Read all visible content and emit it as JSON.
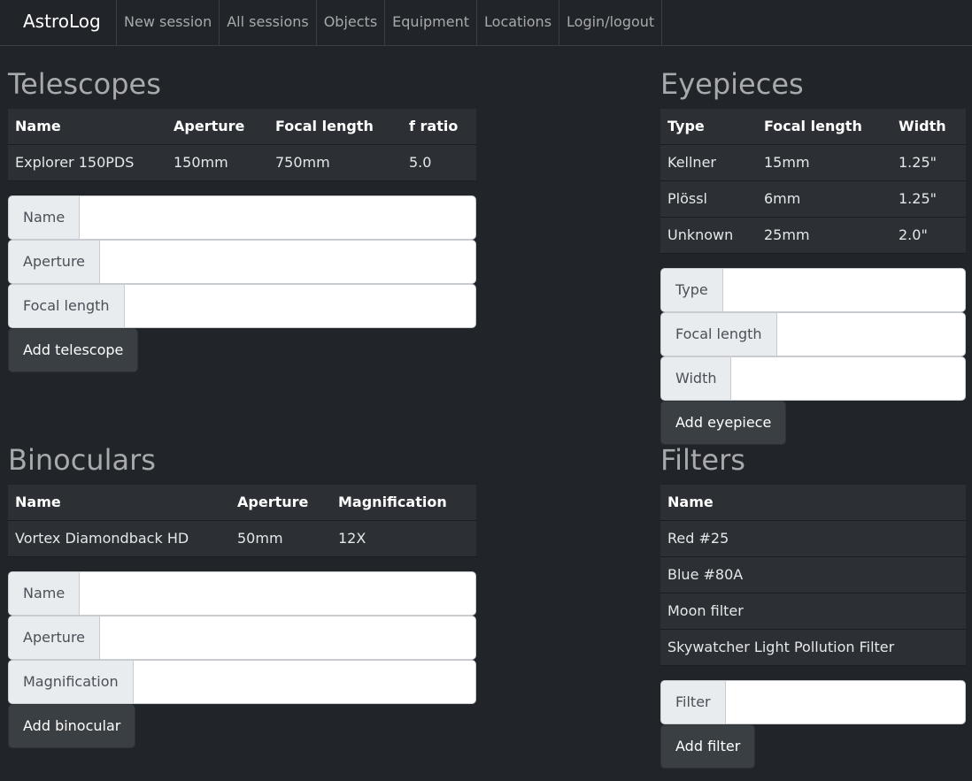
{
  "nav": {
    "brand": "AstroLog",
    "items": [
      "New session",
      "All sessions",
      "Objects",
      "Equipment",
      "Locations",
      "Login/logout"
    ]
  },
  "telescopes": {
    "title": "Telescopes",
    "headers": [
      "Name",
      "Aperture",
      "Focal length",
      "f ratio"
    ],
    "rows": [
      [
        "Explorer 150PDS",
        "150mm",
        "750mm",
        "5.0"
      ]
    ],
    "form": {
      "fields": [
        "Name",
        "Aperture",
        "Focal length"
      ],
      "button": "Add telescope"
    }
  },
  "eyepieces": {
    "title": "Eyepieces",
    "headers": [
      "Type",
      "Focal length",
      "Width"
    ],
    "rows": [
      [
        "Kellner",
        "15mm",
        "1.25\""
      ],
      [
        "Plössl",
        "6mm",
        "1.25\""
      ],
      [
        "Unknown",
        "25mm",
        "2.0\""
      ]
    ],
    "form": {
      "fields": [
        "Type",
        "Focal length",
        "Width"
      ],
      "button": "Add eyepiece"
    }
  },
  "binoculars": {
    "title": "Binoculars",
    "headers": [
      "Name",
      "Aperture",
      "Magnification"
    ],
    "rows": [
      [
        "Vortex Diamondback HD",
        "50mm",
        "12X"
      ]
    ],
    "form": {
      "fields": [
        "Name",
        "Aperture",
        "Magnification"
      ],
      "button": "Add binocular"
    }
  },
  "filters": {
    "title": "Filters",
    "headers": [
      "Name"
    ],
    "rows": [
      [
        "Red #25"
      ],
      [
        "Blue #80A"
      ],
      [
        "Moon filter"
      ],
      [
        "Skywatcher Light Pollution Filter"
      ]
    ],
    "form": {
      "fields": [
        "Filter"
      ],
      "button": "Add filter"
    }
  }
}
